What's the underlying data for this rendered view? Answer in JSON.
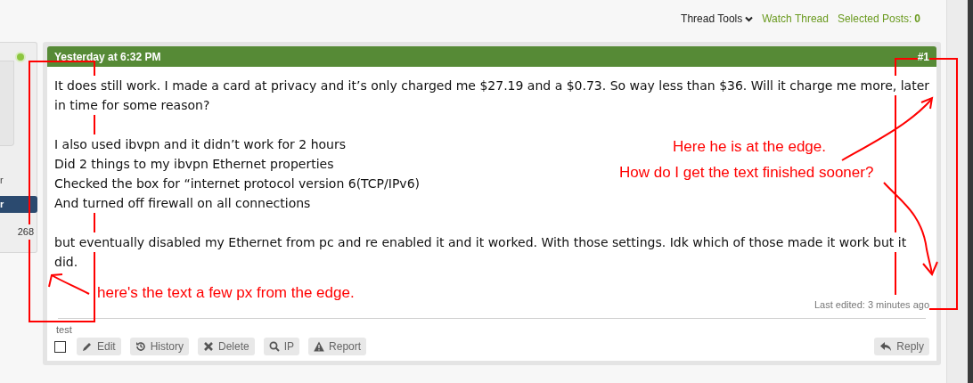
{
  "toolbar": [
    {
      "kind": "menu",
      "label": "Thread Tools"
    },
    {
      "kind": "link",
      "label": "Watch Thread"
    },
    {
      "kind": "count",
      "label": "Selected Posts:",
      "value": "0"
    }
  ],
  "user_panel": {
    "online": true,
    "title": "r",
    "banner": "r",
    "count": "268"
  },
  "post": {
    "date": "Yesterday at 6:32 PM",
    "number": "#1",
    "paragraphs": [
      [
        "It does still work. I made a card at privacy and it’s only charged me $27.19 and a $0.73. So way less than $36. Will it charge me more, later",
        "in time for some reason?"
      ],
      [
        "I also used ibvpn and it didn’t work for 2 hours",
        "Did 2 things to my ibvpn Ethernet properties",
        "Checked the box for “internet protocol version 6(TCP/IPv6)",
        "And turned off firewall on all connections"
      ],
      [
        "but eventually disabled my Ethernet from pc and re enabled it and it worked. With those settings. Idk which of those made it work but it",
        "did."
      ]
    ],
    "last_edited": "Last edited: 3 minutes ago",
    "signature": "test",
    "selected": false,
    "actions": [
      "Edit",
      "History",
      "Delete",
      "IP",
      "Report"
    ],
    "reply": "Reply"
  },
  "annotations": {
    "right_notes": [
      "Here he is at the edge.",
      "How do I get the text finished sooner?"
    ],
    "left_note": "here's the text a few px from the edge."
  }
}
